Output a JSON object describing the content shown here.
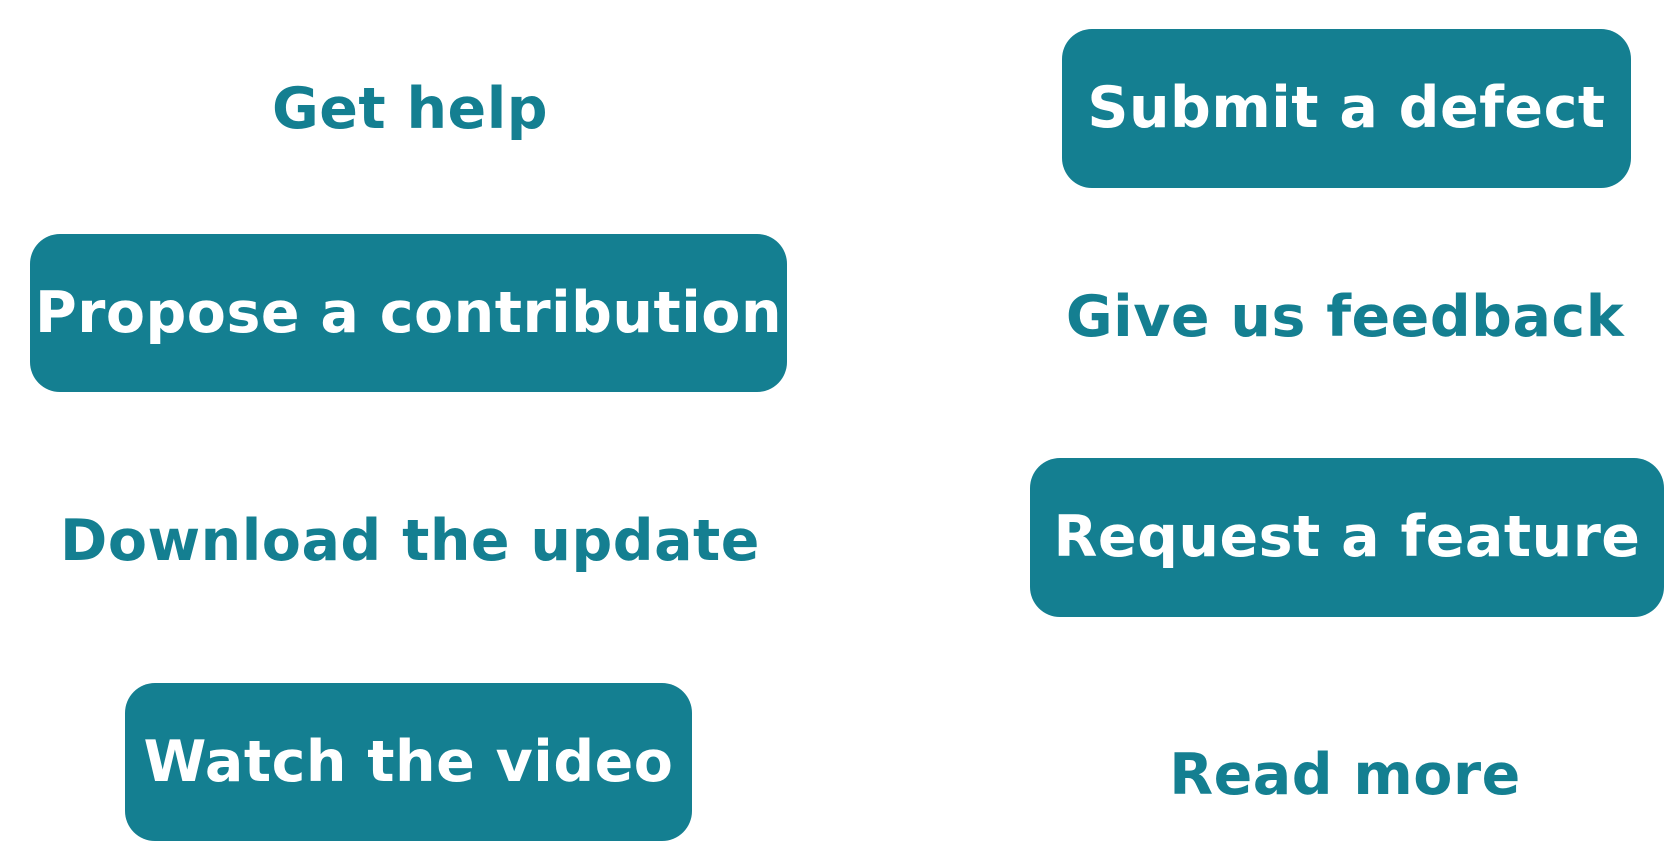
{
  "colors": {
    "primary": "#147f91",
    "on_primary": "#ffffff",
    "background": "#ffffff"
  },
  "buttons": {
    "get_help": "Get help",
    "submit_defect": "Submit a defect",
    "propose_contribution": "Propose a contribution",
    "give_feedback": "Give us feedback",
    "download_update": "Download the update",
    "request_feature": "Request a feature",
    "watch_video": "Watch the video",
    "read_more": "Read more"
  }
}
